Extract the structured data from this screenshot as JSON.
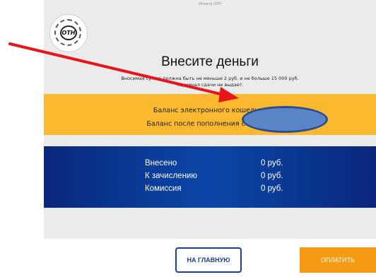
{
  "header": {
    "small_title": "Оплата ОТН",
    "logo_text": "ОТН"
  },
  "main": {
    "heading": "Внесите деньги",
    "note_line1": "Вносимая сумма должна быть не меньше 2 руб. и не больше 15 000 руб.",
    "note_line2": "Терминал сдачи не выдает."
  },
  "balance": {
    "wallet_label": "Баланс электронного кошелька",
    "after_label": "Баланс после пополнения составит"
  },
  "summary": {
    "rows": [
      {
        "label": "Внесено",
        "value": "0 руб."
      },
      {
        "label": "К зачислению",
        "value": "0 руб."
      },
      {
        "label": "Комиссия",
        "value": "0 руб."
      }
    ]
  },
  "buttons": {
    "home_label": "НА ГЛАВНУЮ",
    "pay_label": "ОПЛАТИТЬ"
  },
  "colors": {
    "orange_band": "#fbb92f",
    "blue_band": "#0b47a8",
    "pay_button": "#f59a12",
    "annotation_arrow": "#e8141b",
    "redaction_blob": "#5a86c9"
  }
}
